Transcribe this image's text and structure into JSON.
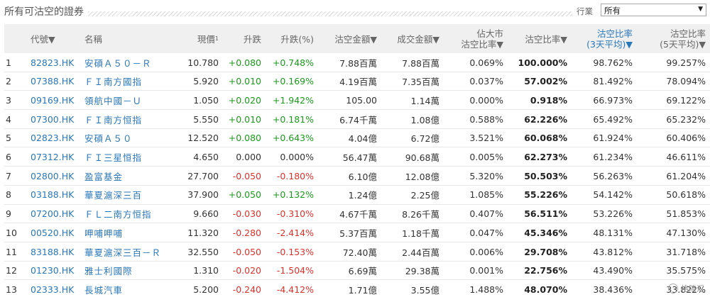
{
  "page": {
    "title": "所有可沽空的證券"
  },
  "filter": {
    "label": "行業",
    "selected": "所有"
  },
  "columns": {
    "code": "代號▼",
    "name": "名稱",
    "price": "現價",
    "price_note": "1",
    "change": "升跌",
    "change_pct": "升跌(%)",
    "short_amount": "沽空金額▼",
    "turnover": "成交金額▼",
    "mkt_ratio_1": "佔大市",
    "mkt_ratio_2": "沽空比率▼",
    "short_ratio": "沽空比率▼",
    "ratio3_1": "沽空比率",
    "ratio3_2": "(3天平均)▼",
    "ratio5_1": "沽空比率",
    "ratio5_2": "(5天平均)▼"
  },
  "rows": [
    {
      "n": "1",
      "code": "82823.HK",
      "name": "安碩Ａ５０－Ｒ",
      "price": "10.780",
      "chg": "+0.080",
      "pct": "+0.748%",
      "short": "7.88百萬",
      "turn": "7.88百萬",
      "mkt": "0.069%",
      "ratio": "100.000%",
      "r3": "98.762%",
      "r5": "99.257%",
      "dir": "pos"
    },
    {
      "n": "2",
      "code": "07388.HK",
      "name": "ＦＩ南方國指",
      "price": "5.920",
      "chg": "+0.010",
      "pct": "+0.169%",
      "short": "4.19百萬",
      "turn": "7.35百萬",
      "mkt": "0.037%",
      "ratio": "57.002%",
      "r3": "81.492%",
      "r5": "78.094%",
      "dir": "pos"
    },
    {
      "n": "3",
      "code": "09169.HK",
      "name": "領航中國－Ｕ",
      "price": "1.050",
      "chg": "+0.020",
      "pct": "+1.942%",
      "short": "105.00",
      "turn": "1.14萬",
      "mkt": "0.000%",
      "ratio": "0.918%",
      "r3": "66.973%",
      "r5": "69.122%",
      "dir": "pos"
    },
    {
      "n": "4",
      "code": "07300.HK",
      "name": "ＦＩ南方恒指",
      "price": "5.550",
      "chg": "+0.010",
      "pct": "+0.181%",
      "short": "6.74千萬",
      "turn": "1.08億",
      "mkt": "0.588%",
      "ratio": "62.226%",
      "r3": "65.492%",
      "r5": "65.232%",
      "dir": "pos"
    },
    {
      "n": "5",
      "code": "02823.HK",
      "name": "安碩Ａ５０",
      "price": "12.520",
      "chg": "+0.080",
      "pct": "+0.643%",
      "short": "4.04億",
      "turn": "6.72億",
      "mkt": "3.521%",
      "ratio": "60.068%",
      "r3": "61.924%",
      "r5": "60.406%",
      "dir": "pos"
    },
    {
      "n": "6",
      "code": "07312.HK",
      "name": "ＦＩ三星恒指",
      "price": "4.650",
      "chg": "0.000",
      "pct": "0.000%",
      "short": "56.47萬",
      "turn": "90.68萬",
      "mkt": "0.005%",
      "ratio": "62.273%",
      "r3": "61.234%",
      "r5": "46.611%",
      "dir": "flat"
    },
    {
      "n": "7",
      "code": "02800.HK",
      "name": "盈富基金",
      "price": "27.700",
      "chg": "-0.050",
      "pct": "-0.180%",
      "short": "6.10億",
      "turn": "12.08億",
      "mkt": "5.320%",
      "ratio": "50.503%",
      "r3": "56.263%",
      "r5": "61.204%",
      "dir": "neg"
    },
    {
      "n": "8",
      "code": "03188.HK",
      "name": "華夏滬深三百",
      "price": "37.900",
      "chg": "+0.050",
      "pct": "+0.132%",
      "short": "1.24億",
      "turn": "2.25億",
      "mkt": "1.085%",
      "ratio": "55.226%",
      "r3": "54.142%",
      "r5": "50.618%",
      "dir": "pos"
    },
    {
      "n": "9",
      "code": "07200.HK",
      "name": "ＦＬ二南方恒指",
      "price": "9.660",
      "chg": "-0.030",
      "pct": "-0.310%",
      "short": "4.67千萬",
      "turn": "8.26千萬",
      "mkt": "0.407%",
      "ratio": "56.511%",
      "r3": "53.226%",
      "r5": "51.853%",
      "dir": "neg"
    },
    {
      "n": "10",
      "code": "00520.HK",
      "name": "呷哺呷哺",
      "price": "11.320",
      "chg": "-0.280",
      "pct": "-2.414%",
      "short": "5.37百萬",
      "turn": "1.18千萬",
      "mkt": "0.047%",
      "ratio": "45.346%",
      "r3": "48.131%",
      "r5": "47.130%",
      "dir": "neg"
    },
    {
      "n": "11",
      "code": "83188.HK",
      "name": "華夏滬深三百－Ｒ",
      "price": "32.550",
      "chg": "-0.050",
      "pct": "-0.153%",
      "short": "72.40萬",
      "turn": "2.44百萬",
      "mkt": "0.006%",
      "ratio": "29.708%",
      "r3": "43.812%",
      "r5": "31.718%",
      "dir": "neg"
    },
    {
      "n": "12",
      "code": "01230.HK",
      "name": "雅士利國際",
      "price": "1.310",
      "chg": "-0.020",
      "pct": "-1.504%",
      "short": "6.69萬",
      "turn": "29.38萬",
      "mkt": "0.001%",
      "ratio": "22.756%",
      "r3": "43.490%",
      "r5": "35.575%",
      "dir": "neg"
    },
    {
      "n": "13",
      "code": "02333.HK",
      "name": "長城汽車",
      "price": "5.200",
      "chg": "-0.240",
      "pct": "-4.412%",
      "short": "1.71億",
      "turn": "3.55億",
      "mkt": "1.488%",
      "ratio": "48.070%",
      "r3": "38.436%",
      "r5": "33.822%",
      "dir": "neg"
    }
  ],
  "watermark": {
    "text": "格隆汇"
  },
  "colors": {
    "link": "#2a77b8",
    "up": "#1a9a1a",
    "down": "#e0302a",
    "header_bg": "#f0f0f0"
  }
}
